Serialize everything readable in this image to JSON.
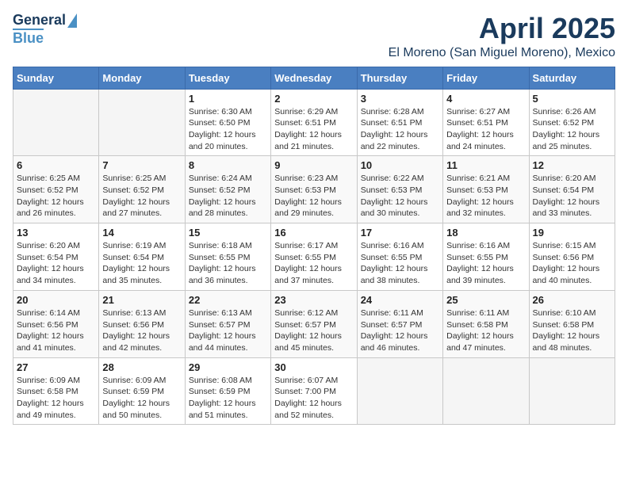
{
  "header": {
    "logo_line1": "General",
    "logo_line2": "Blue",
    "title": "April 2025",
    "subtitle": "El Moreno (San Miguel Moreno), Mexico"
  },
  "weekdays": [
    "Sunday",
    "Monday",
    "Tuesday",
    "Wednesday",
    "Thursday",
    "Friday",
    "Saturday"
  ],
  "weeks": [
    [
      {
        "day": "",
        "info": ""
      },
      {
        "day": "",
        "info": ""
      },
      {
        "day": "1",
        "info": "Sunrise: 6:30 AM\nSunset: 6:50 PM\nDaylight: 12 hours and 20 minutes."
      },
      {
        "day": "2",
        "info": "Sunrise: 6:29 AM\nSunset: 6:51 PM\nDaylight: 12 hours and 21 minutes."
      },
      {
        "day": "3",
        "info": "Sunrise: 6:28 AM\nSunset: 6:51 PM\nDaylight: 12 hours and 22 minutes."
      },
      {
        "day": "4",
        "info": "Sunrise: 6:27 AM\nSunset: 6:51 PM\nDaylight: 12 hours and 24 minutes."
      },
      {
        "day": "5",
        "info": "Sunrise: 6:26 AM\nSunset: 6:52 PM\nDaylight: 12 hours and 25 minutes."
      }
    ],
    [
      {
        "day": "6",
        "info": "Sunrise: 6:25 AM\nSunset: 6:52 PM\nDaylight: 12 hours and 26 minutes."
      },
      {
        "day": "7",
        "info": "Sunrise: 6:25 AM\nSunset: 6:52 PM\nDaylight: 12 hours and 27 minutes."
      },
      {
        "day": "8",
        "info": "Sunrise: 6:24 AM\nSunset: 6:52 PM\nDaylight: 12 hours and 28 minutes."
      },
      {
        "day": "9",
        "info": "Sunrise: 6:23 AM\nSunset: 6:53 PM\nDaylight: 12 hours and 29 minutes."
      },
      {
        "day": "10",
        "info": "Sunrise: 6:22 AM\nSunset: 6:53 PM\nDaylight: 12 hours and 30 minutes."
      },
      {
        "day": "11",
        "info": "Sunrise: 6:21 AM\nSunset: 6:53 PM\nDaylight: 12 hours and 32 minutes."
      },
      {
        "day": "12",
        "info": "Sunrise: 6:20 AM\nSunset: 6:54 PM\nDaylight: 12 hours and 33 minutes."
      }
    ],
    [
      {
        "day": "13",
        "info": "Sunrise: 6:20 AM\nSunset: 6:54 PM\nDaylight: 12 hours and 34 minutes."
      },
      {
        "day": "14",
        "info": "Sunrise: 6:19 AM\nSunset: 6:54 PM\nDaylight: 12 hours and 35 minutes."
      },
      {
        "day": "15",
        "info": "Sunrise: 6:18 AM\nSunset: 6:55 PM\nDaylight: 12 hours and 36 minutes."
      },
      {
        "day": "16",
        "info": "Sunrise: 6:17 AM\nSunset: 6:55 PM\nDaylight: 12 hours and 37 minutes."
      },
      {
        "day": "17",
        "info": "Sunrise: 6:16 AM\nSunset: 6:55 PM\nDaylight: 12 hours and 38 minutes."
      },
      {
        "day": "18",
        "info": "Sunrise: 6:16 AM\nSunset: 6:55 PM\nDaylight: 12 hours and 39 minutes."
      },
      {
        "day": "19",
        "info": "Sunrise: 6:15 AM\nSunset: 6:56 PM\nDaylight: 12 hours and 40 minutes."
      }
    ],
    [
      {
        "day": "20",
        "info": "Sunrise: 6:14 AM\nSunset: 6:56 PM\nDaylight: 12 hours and 41 minutes."
      },
      {
        "day": "21",
        "info": "Sunrise: 6:13 AM\nSunset: 6:56 PM\nDaylight: 12 hours and 42 minutes."
      },
      {
        "day": "22",
        "info": "Sunrise: 6:13 AM\nSunset: 6:57 PM\nDaylight: 12 hours and 44 minutes."
      },
      {
        "day": "23",
        "info": "Sunrise: 6:12 AM\nSunset: 6:57 PM\nDaylight: 12 hours and 45 minutes."
      },
      {
        "day": "24",
        "info": "Sunrise: 6:11 AM\nSunset: 6:57 PM\nDaylight: 12 hours and 46 minutes."
      },
      {
        "day": "25",
        "info": "Sunrise: 6:11 AM\nSunset: 6:58 PM\nDaylight: 12 hours and 47 minutes."
      },
      {
        "day": "26",
        "info": "Sunrise: 6:10 AM\nSunset: 6:58 PM\nDaylight: 12 hours and 48 minutes."
      }
    ],
    [
      {
        "day": "27",
        "info": "Sunrise: 6:09 AM\nSunset: 6:58 PM\nDaylight: 12 hours and 49 minutes."
      },
      {
        "day": "28",
        "info": "Sunrise: 6:09 AM\nSunset: 6:59 PM\nDaylight: 12 hours and 50 minutes."
      },
      {
        "day": "29",
        "info": "Sunrise: 6:08 AM\nSunset: 6:59 PM\nDaylight: 12 hours and 51 minutes."
      },
      {
        "day": "30",
        "info": "Sunrise: 6:07 AM\nSunset: 7:00 PM\nDaylight: 12 hours and 52 minutes."
      },
      {
        "day": "",
        "info": ""
      },
      {
        "day": "",
        "info": ""
      },
      {
        "day": "",
        "info": ""
      }
    ]
  ]
}
